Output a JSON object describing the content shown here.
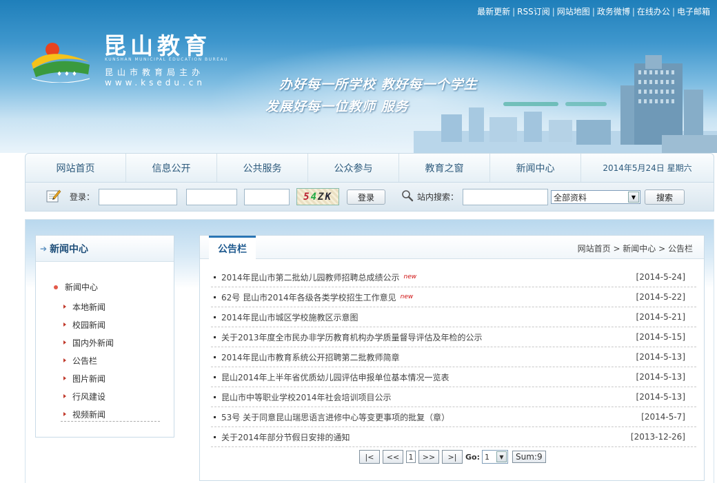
{
  "top_links": [
    "最新更新",
    "RSS订阅",
    "网站地图",
    "政务微博",
    "在线办公",
    "电子邮箱"
  ],
  "brand": {
    "title": "昆山教育",
    "title_en": "KUNSHAN MUNICIPAL EDUCATION BUREAU",
    "sponsor": "昆山市教育局主办",
    "url": "www.ksedu.cn",
    "slogan_line1": "办好每一所学校  教好每一个学生",
    "slogan_line2": "发展好每一位教师  服务"
  },
  "nav": {
    "items": [
      "网站首页",
      "信息公开",
      "公共服务",
      "公众参与",
      "教育之窗",
      "新闻中心"
    ],
    "date": "2014年5月24日 星期六"
  },
  "login": {
    "label": "登录：",
    "captcha": [
      "5",
      "4",
      "Z",
      "K"
    ],
    "login_button": "登录",
    "search_label": "站内搜索：",
    "search_scope": "全部资料",
    "search_button": "搜索"
  },
  "sidebar": {
    "title": "新闻中心",
    "root": "新闻中心",
    "items": [
      "本地新闻",
      "校园新闻",
      "国内外新闻",
      "公告栏",
      "图片新闻",
      "行风建设",
      "视频新闻"
    ]
  },
  "content": {
    "tab": "公告栏",
    "breadcrumb": "网站首页 > 新闻中心 > 公告栏",
    "news": [
      {
        "title": "2014年昆山市第二批幼儿园教师招聘总成绩公示",
        "new": "new",
        "date": "[2014-5-24]"
      },
      {
        "title": "62号 昆山市2014年各级各类学校招生工作意见",
        "new": "new",
        "date": "[2014-5-22]"
      },
      {
        "title": "2014年昆山市城区学校施教区示意图",
        "new": "",
        "date": "[2014-5-21]"
      },
      {
        "title": "关于2013年度全市民办非学历教育机构办学质量督导评估及年检的公示",
        "new": "",
        "date": "[2014-5-15]"
      },
      {
        "title": "2014年昆山市教育系统公开招聘第二批教师简章",
        "new": "",
        "date": "[2014-5-13]"
      },
      {
        "title": "昆山2014年上半年省优质幼儿园评估申报单位基本情况一览表",
        "new": "",
        "date": "[2014-5-13]"
      },
      {
        "title": "昆山市中等职业学校2014年社会培训项目公示",
        "new": "",
        "date": "[2014-5-13]"
      },
      {
        "title": "53号 关于同意昆山瑞思语言进修中心等变更事项的批复（章）",
        "new": "",
        "date": "[2014-5-7]"
      },
      {
        "title": "关于2014年部分节假日安排的通知",
        "new": "",
        "date": "[2013-12-26]"
      }
    ],
    "pager": {
      "first": "|<",
      "prev": "<<",
      "current": "1",
      "next": ">>",
      "last": ">|",
      "go_label": "Go:",
      "go_value": "1",
      "sum": "Sum:9"
    }
  }
}
